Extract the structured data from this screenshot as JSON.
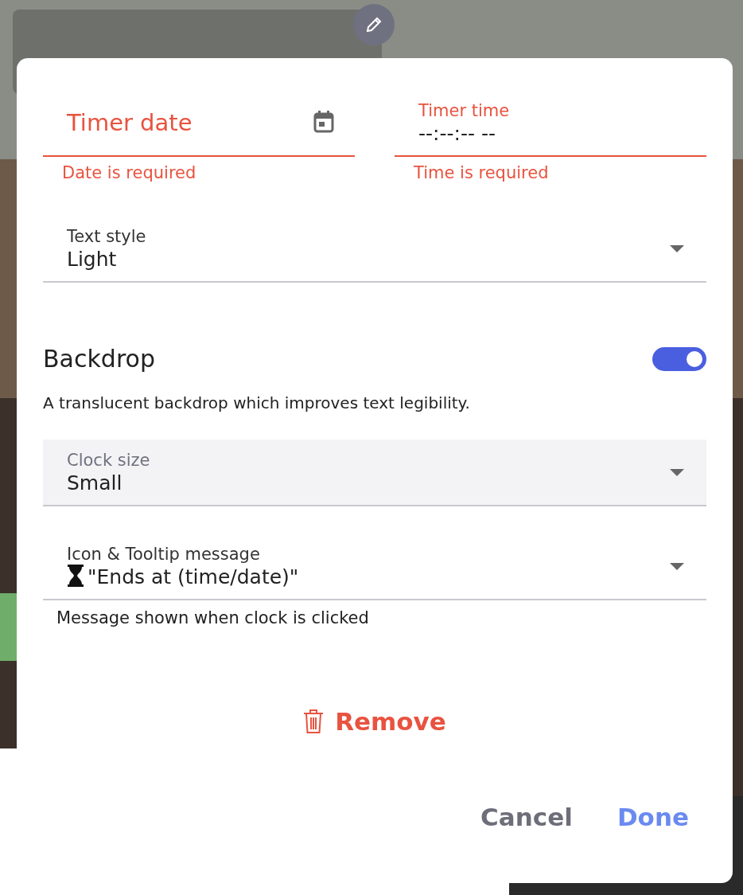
{
  "dialog": {
    "date_field": {
      "label": "Timer date",
      "error": true,
      "error_text": "Date is required"
    },
    "time_field": {
      "label": "Timer time",
      "value": "--:--:-- --",
      "error": true,
      "error_text": "Time is required"
    },
    "text_style": {
      "label": "Text style",
      "value": "Light",
      "highlighted": false
    },
    "backdrop": {
      "label": "Backdrop",
      "on": true,
      "description": "A translucent backdrop which improves text legibility."
    },
    "clock_size": {
      "label": "Clock size",
      "value": "Small",
      "highlighted": true
    },
    "tooltip": {
      "label": "Icon & Tooltip message",
      "value": "\"Ends at (time/date)\"",
      "highlighted": false,
      "helper": "Message shown when clock is clicked"
    },
    "remove_button": "Remove",
    "buttons": [
      {
        "label": "Cancel",
        "kind": "secondary"
      },
      {
        "label": "Done",
        "kind": "primary"
      }
    ]
  }
}
